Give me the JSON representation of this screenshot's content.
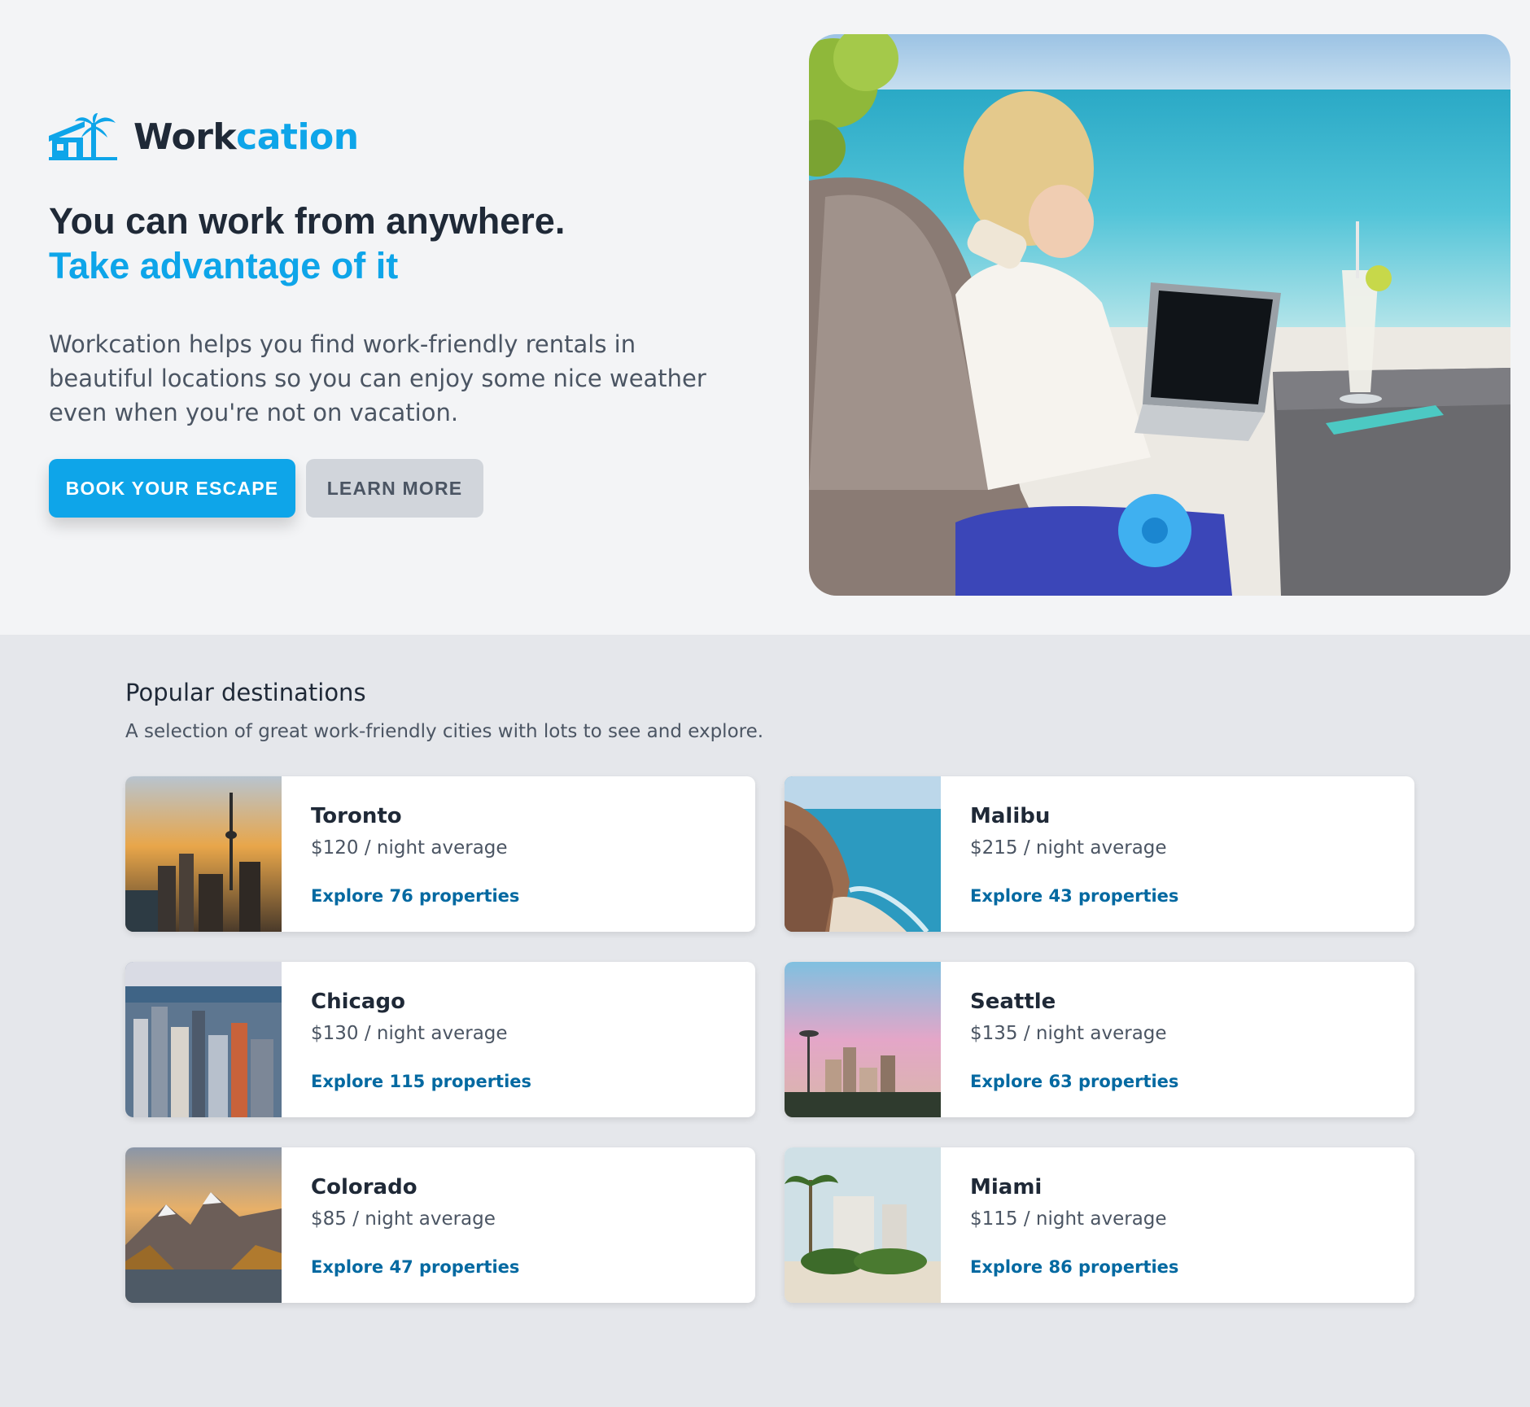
{
  "brand": {
    "name_part1": "Work",
    "name_part2": "cation",
    "accent": "#0ea5e9"
  },
  "hero": {
    "headline_line1": "You can work from anywhere.",
    "headline_line2": "Take advantage of it",
    "description": "Workcation helps you find work-friendly rentals in beautiful locations so you can enjoy some nice weather even when you're not on vacation.",
    "primary_button": "BOOK YOUR ESCAPE",
    "secondary_button": "LEARN MORE"
  },
  "destinations": {
    "title": "Popular destinations",
    "subtitle": "A selection of great work-friendly cities with lots to see and explore.",
    "cities": [
      {
        "name": "Toronto",
        "price": "$120 / night average",
        "link": "Explore 76 properties"
      },
      {
        "name": "Malibu",
        "price": "$215 / night average",
        "link": "Explore 43 properties"
      },
      {
        "name": "Chicago",
        "price": "$130 / night average",
        "link": "Explore 115 properties"
      },
      {
        "name": "Seattle",
        "price": "$135 / night average",
        "link": "Explore 63 properties"
      },
      {
        "name": "Colorado",
        "price": "$85 / night average",
        "link": "Explore 47 properties"
      },
      {
        "name": "Miami",
        "price": "$115 / night average",
        "link": "Explore 86 properties"
      }
    ]
  }
}
